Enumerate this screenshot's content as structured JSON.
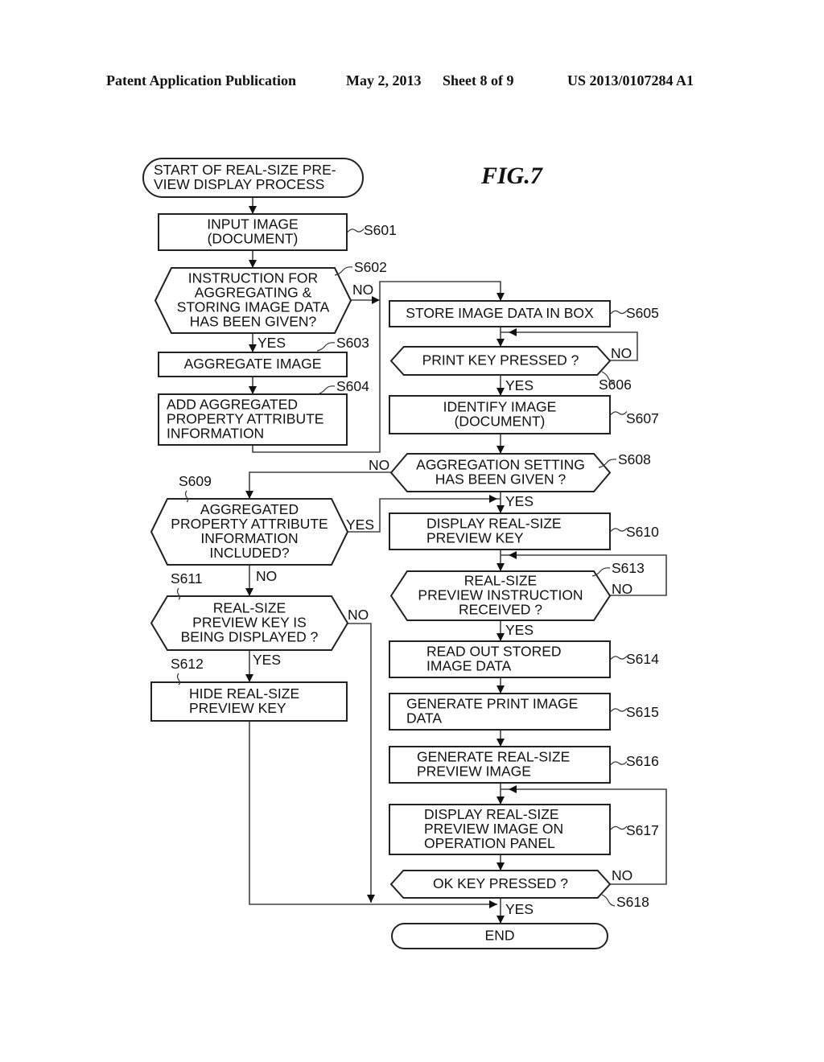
{
  "header": {
    "publication": "Patent Application Publication",
    "date": "May 2, 2013",
    "sheet": "Sheet 8 of 9",
    "number": "US 2013/0107284 A1"
  },
  "figure_label": "FIG.7",
  "nodes": {
    "start": {
      "lines": [
        "START OF REAL-SIZE PRE-",
        "VIEW DISPLAY PROCESS"
      ]
    },
    "s601": {
      "step": "S601",
      "lines": [
        "INPUT IMAGE",
        "(DOCUMENT)"
      ]
    },
    "s602": {
      "step": "S602",
      "lines": [
        "INSTRUCTION FOR",
        "AGGREGATING &",
        "STORING IMAGE DATA",
        "HAS BEEN GIVEN?"
      ]
    },
    "s603": {
      "step": "S603",
      "lines": [
        "AGGREGATE IMAGE"
      ]
    },
    "s604": {
      "step": "S604",
      "lines": [
        "ADD AGGREGATED",
        "PROPERTY ATTRIBUTE",
        "INFORMATION"
      ]
    },
    "s605": {
      "step": "S605",
      "lines": [
        "STORE IMAGE DATA IN BOX"
      ]
    },
    "s606": {
      "step": "S606",
      "lines": [
        "PRINT KEY PRESSED ?"
      ]
    },
    "s607": {
      "step": "S607",
      "lines": [
        "IDENTIFY IMAGE",
        "(DOCUMENT)"
      ]
    },
    "s608": {
      "step": "S608",
      "lines": [
        "AGGREGATION SETTING",
        "HAS BEEN GIVEN ?"
      ]
    },
    "s609": {
      "step": "S609",
      "lines": [
        "AGGREGATED",
        "PROPERTY ATTRIBUTE",
        "INFORMATION",
        "INCLUDED?"
      ]
    },
    "s610": {
      "step": "S610",
      "lines": [
        "DISPLAY REAL-SIZE",
        "PREVIEW KEY"
      ]
    },
    "s611": {
      "step": "S611",
      "lines": [
        "REAL-SIZE",
        "PREVIEW KEY IS",
        "BEING DISPLAYED ?"
      ]
    },
    "s612": {
      "step": "S612",
      "lines": [
        "HIDE REAL-SIZE",
        "PREVIEW KEY"
      ]
    },
    "s613": {
      "step": "S613",
      "lines": [
        "REAL-SIZE",
        "PREVIEW INSTRUCTION",
        "RECEIVED ?"
      ]
    },
    "s614": {
      "step": "S614",
      "lines": [
        "READ OUT STORED",
        "IMAGE DATA"
      ]
    },
    "s615": {
      "step": "S615",
      "lines": [
        "GENERATE PRINT IMAGE",
        "DATA"
      ]
    },
    "s616": {
      "step": "S616",
      "lines": [
        "GENERATE REAL-SIZE",
        "PREVIEW IMAGE"
      ]
    },
    "s617": {
      "step": "S617",
      "lines": [
        "DISPLAY REAL-SIZE",
        "PREVIEW IMAGE ON",
        "OPERATION PANEL"
      ]
    },
    "s618": {
      "step": "S618",
      "lines": [
        "OK KEY PRESSED ?"
      ]
    },
    "end": {
      "lines": [
        "END"
      ]
    }
  },
  "edge_labels": {
    "yes": "YES",
    "no": "NO"
  }
}
